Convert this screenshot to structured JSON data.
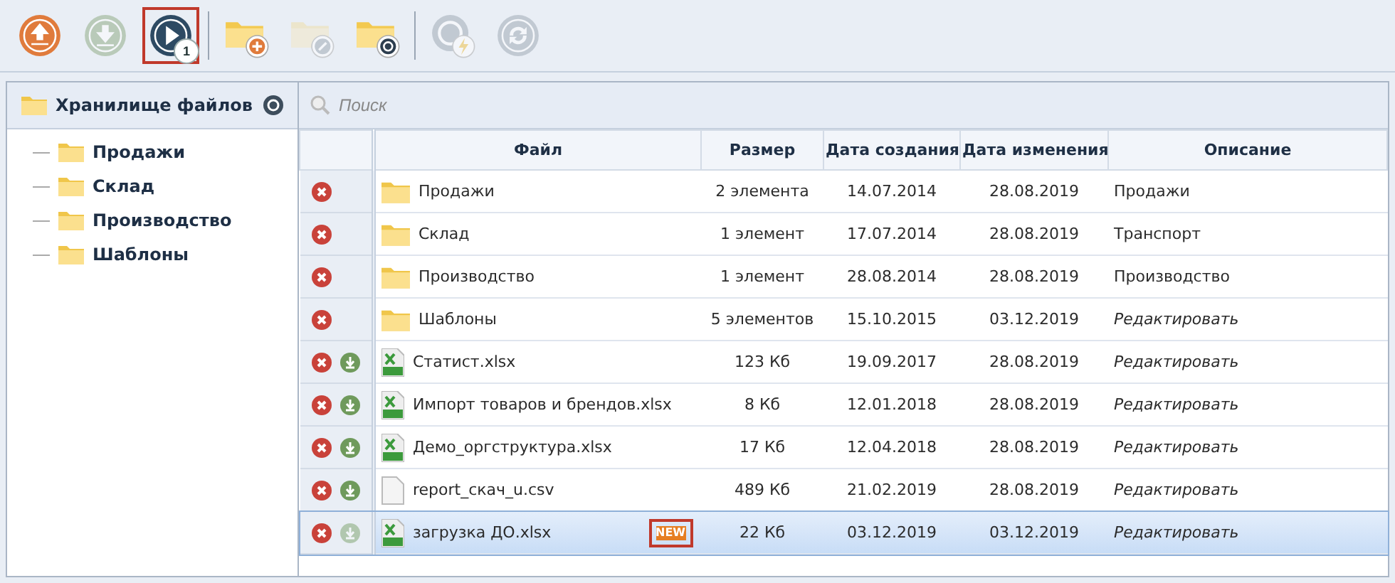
{
  "toolbar": [
    {
      "kind": "upload",
      "disabled": false,
      "highlighted": false
    },
    {
      "kind": "download",
      "disabled": true,
      "highlighted": false
    },
    {
      "kind": "play",
      "disabled": false,
      "highlighted": true,
      "badge": "1"
    },
    {
      "kind": "folder-add",
      "disabled": false,
      "highlighted": false
    },
    {
      "kind": "folder-edit",
      "disabled": true,
      "highlighted": false
    },
    {
      "kind": "folder-sync",
      "disabled": false,
      "highlighted": false
    },
    {
      "kind": "sync-flash",
      "disabled": true,
      "highlighted": false
    },
    {
      "kind": "sync",
      "disabled": true,
      "highlighted": false
    }
  ],
  "sidebar": {
    "title": "Хранилище файлов",
    "items": [
      {
        "label": "Продажи"
      },
      {
        "label": "Склад"
      },
      {
        "label": "Производство"
      },
      {
        "label": "Шаблоны"
      }
    ]
  },
  "search": {
    "placeholder": "Поиск"
  },
  "table": {
    "columns": [
      "Файл",
      "Размер",
      "Дата создания",
      "Дата изменения",
      "Описание"
    ],
    "rows": [
      {
        "kind": "folder",
        "name": "Продажи",
        "size": "2 элемента",
        "created": "14.07.2014",
        "modified": "28.08.2019",
        "description": "Продажи",
        "placeholder": false,
        "selected": false
      },
      {
        "kind": "folder",
        "name": "Склад",
        "size": "1 элемент",
        "created": "17.07.2014",
        "modified": "28.08.2019",
        "description": "Транспорт",
        "placeholder": false,
        "selected": false
      },
      {
        "kind": "folder",
        "name": "Производство",
        "size": "1 элемент",
        "created": "28.08.2014",
        "modified": "28.08.2019",
        "description": "Производство",
        "placeholder": false,
        "selected": false
      },
      {
        "kind": "folder",
        "name": "Шаблоны",
        "size": "5 элементов",
        "created": "15.10.2015",
        "modified": "03.12.2019",
        "description": "Редактировать",
        "placeholder": true,
        "selected": false
      },
      {
        "kind": "xlsx",
        "name": "Статист.xlsx",
        "size": "123 Кб",
        "created": "19.09.2017",
        "modified": "28.08.2019",
        "description": "Редактировать",
        "placeholder": true,
        "download_enabled": true,
        "selected": false
      },
      {
        "kind": "xlsx",
        "name": "Импорт товаров и брендов.xlsx",
        "size": "8 Кб",
        "created": "12.01.2018",
        "modified": "28.08.2019",
        "description": "Редактировать",
        "placeholder": true,
        "download_enabled": true,
        "selected": false
      },
      {
        "kind": "xlsx",
        "name": "Демо_оргструктура.xlsx",
        "size": "17 Кб",
        "created": "12.04.2018",
        "modified": "28.08.2019",
        "description": "Редактировать",
        "placeholder": true,
        "download_enabled": true,
        "selected": false
      },
      {
        "kind": "csv",
        "name": "report_скач_u.csv",
        "size": "489 Кб",
        "created": "21.02.2019",
        "modified": "28.08.2019",
        "description": "Редактировать",
        "placeholder": true,
        "download_enabled": true,
        "selected": false
      },
      {
        "kind": "xlsx",
        "name": "загрузка ДО.xlsx",
        "size": "22 Кб",
        "created": "03.12.2019",
        "modified": "03.12.2019",
        "description": "Редактировать",
        "placeholder": true,
        "download_enabled": false,
        "selected": true,
        "badge": {
          "text": "NEW",
          "highlighted": true
        }
      }
    ]
  }
}
